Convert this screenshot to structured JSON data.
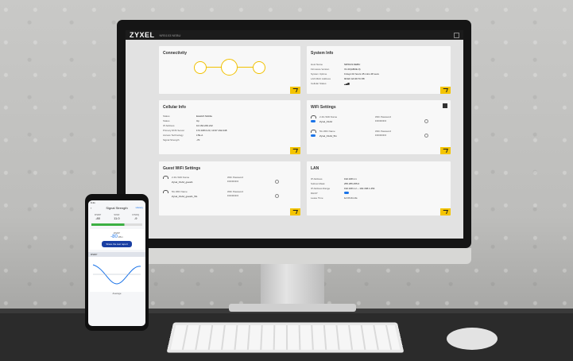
{
  "screen": {
    "brand": "ZYXEL",
    "model": "NR5103 NEBU",
    "cards": {
      "connectivity": {
        "title": "Connectivity"
      },
      "system_info": {
        "title": "System Info",
        "rows": [
          {
            "label": "Host Name",
            "value": "NR5103-NEBU"
          },
          {
            "label": "Firmware Version",
            "value": "V1.00(ABUE.0)"
          },
          {
            "label": "System Uptime",
            "value": "0 days 02 hours 45 mins 28 secs"
          },
          {
            "label": "LAN MAC Address",
            "value": "90:EF:4A:99:7C:88"
          },
          {
            "label": "Cellular Status",
            "value": "▂▄▆"
          }
        ]
      },
      "cellular_info": {
        "title": "Cellular Info",
        "rows": [
          {
            "label": "Status",
            "value": "Eswitch Mobile"
          },
          {
            "label": "Status",
            "value": "Up"
          },
          {
            "label": "IP Address",
            "value": "10.164.249.212"
          },
          {
            "label": "Primary DNS Server",
            "value": "172.168.0.23, 10.97.192.248"
          },
          {
            "label": "Access Technology",
            "value": "LTE-A"
          },
          {
            "label": "Signal Strength",
            "value": "-70"
          }
        ]
      },
      "wifi_settings": {
        "title": "WiFi Settings",
        "rows": [
          {
            "label": "2.4G WiFi Name",
            "name": "Zyxel_F1A2",
            "pw_label": "WiFi Password",
            "pw": "••••••••••"
          },
          {
            "label": "5G WiFi Name",
            "name": "Zyxel_F1A2_5G",
            "pw_label": "WiFi Password",
            "pw": "••••••••••"
          }
        ]
      },
      "guest_wifi": {
        "title": "Guest WiFi Settings",
        "rows": [
          {
            "label": "2.4G WiFi Name",
            "name": "Zyxel_F1A2_guest1",
            "pw_label": "WiFi Password",
            "pw": "••••••••••"
          },
          {
            "label": "5G WiFi Name",
            "name": "Zyxel_F1A2_guest1_5G",
            "pw_label": "WiFi Password",
            "pw": "••••••••••"
          }
        ]
      },
      "lan": {
        "title": "LAN",
        "rows": [
          {
            "label": "IP Address",
            "value": "192.168.1.1"
          },
          {
            "label": "Subnet Mask",
            "value": "255.255.255.0"
          },
          {
            "label": "IP Address Range",
            "value": "192.168.1.2 ~ 192.168.1.254"
          },
          {
            "label": "DHCP",
            "value": ""
          },
          {
            "label": "Lease Time",
            "value": "1d 0h 0m 0s"
          }
        ]
      }
    }
  },
  "phone": {
    "time": "9:41",
    "title": "Signal Strength",
    "history": "History",
    "back": "‹",
    "stats": [
      {
        "label": "RSRP",
        "value": "-80"
      },
      {
        "label": "SINR",
        "value": "11.0"
      },
      {
        "label": "RSRQ",
        "value": "-9"
      }
    ],
    "main_label": "RSRP",
    "main_value": "-80",
    "main_unit": "dBm",
    "button": "Share the test report",
    "chart_header": "RSRP",
    "legend": "Average"
  },
  "colors": {
    "accent": "#f4c400",
    "toggle": "#1a73e8",
    "signal": "#3cb043"
  }
}
